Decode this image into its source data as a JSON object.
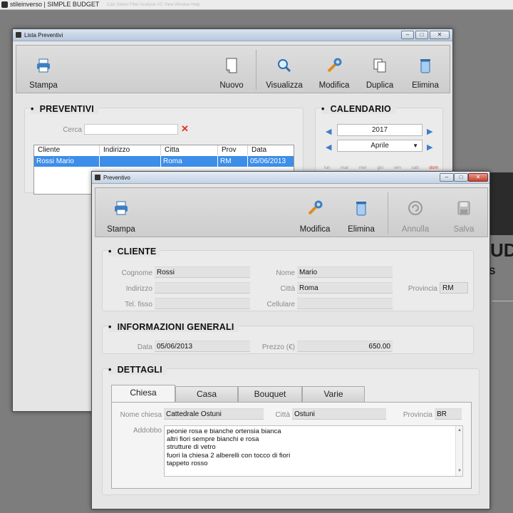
{
  "app": {
    "title": "stileinverso | SIMPLE BUDGET",
    "menu": "Calc    Select    Filter    Analysis    VC    View    Window    Help"
  },
  "lista": {
    "title": "Lista Preventivi",
    "toolbar": {
      "stampa": "Stampa",
      "nuovo": "Nuovo",
      "visualizza": "Visualizza",
      "modifica": "Modifica",
      "duplica": "Duplica",
      "elimina": "Elimina"
    },
    "preventivi": {
      "heading": "PREVENTIVI",
      "search_label": "Cerca",
      "search_value": "",
      "columns": [
        "Cliente",
        "Indirizzo",
        "Citta",
        "Prov",
        "Data"
      ],
      "rows": [
        {
          "cliente": "Rossi Mario",
          "indirizzo": "",
          "citta": "Roma",
          "prov": "RM",
          "data": "05/06/2013"
        }
      ]
    },
    "calendario": {
      "heading": "CALENDARIO",
      "year": "2017",
      "month": "Aprile",
      "weekdays": [
        "lun",
        "mar",
        "mer",
        "gio",
        "ven",
        "sab",
        "dom"
      ]
    }
  },
  "preventivo": {
    "title": "Preventivo",
    "toolbar": {
      "stampa": "Stampa",
      "modifica": "Modifica",
      "elimina": "Elimina",
      "annulla": "Annulla",
      "salva": "Salva"
    },
    "cliente": {
      "heading": "CLIENTE",
      "cognome_label": "Cognome",
      "cognome": "Rossi",
      "nome_label": "Nome",
      "nome": "Mario",
      "indirizzo_label": "Indirizzo",
      "indirizzo": "",
      "citta_label": "Città",
      "citta": "Roma",
      "provincia_label": "Provincia",
      "provincia": "RM",
      "tel_label": "Tel. fisso",
      "tel": "",
      "cellulare_label": "Cellulare",
      "cellulare": ""
    },
    "info": {
      "heading": "INFORMAZIONI GENERALI",
      "data_label": "Data",
      "data": "05/06/2013",
      "prezzo_label": "Prezzo (€)",
      "prezzo": "650.00"
    },
    "dettagli": {
      "heading": "DETTAGLI",
      "tabs": [
        "Chiesa",
        "Casa",
        "Bouquet",
        "Varie"
      ],
      "nome_chiesa_label": "Nome chiesa",
      "nome_chiesa": "Cattedrale Ostuni",
      "citta_label": "Città",
      "citta": "Ostuni",
      "provincia_label": "Provincia",
      "provincia": "BR",
      "addobbo_label": "Addobbo",
      "addobbo_lines": [
        "peonie rosa e bianche ortensia bianca",
        "altri fiori sempre bianchi e rosa",
        "strutture di vetro",
        "fuori la chiesa 2 alberelli con tocco di fiori",
        "tappeto rosso"
      ]
    }
  },
  "background": {
    "brand_text": "UD",
    "brand_sub": "S"
  }
}
